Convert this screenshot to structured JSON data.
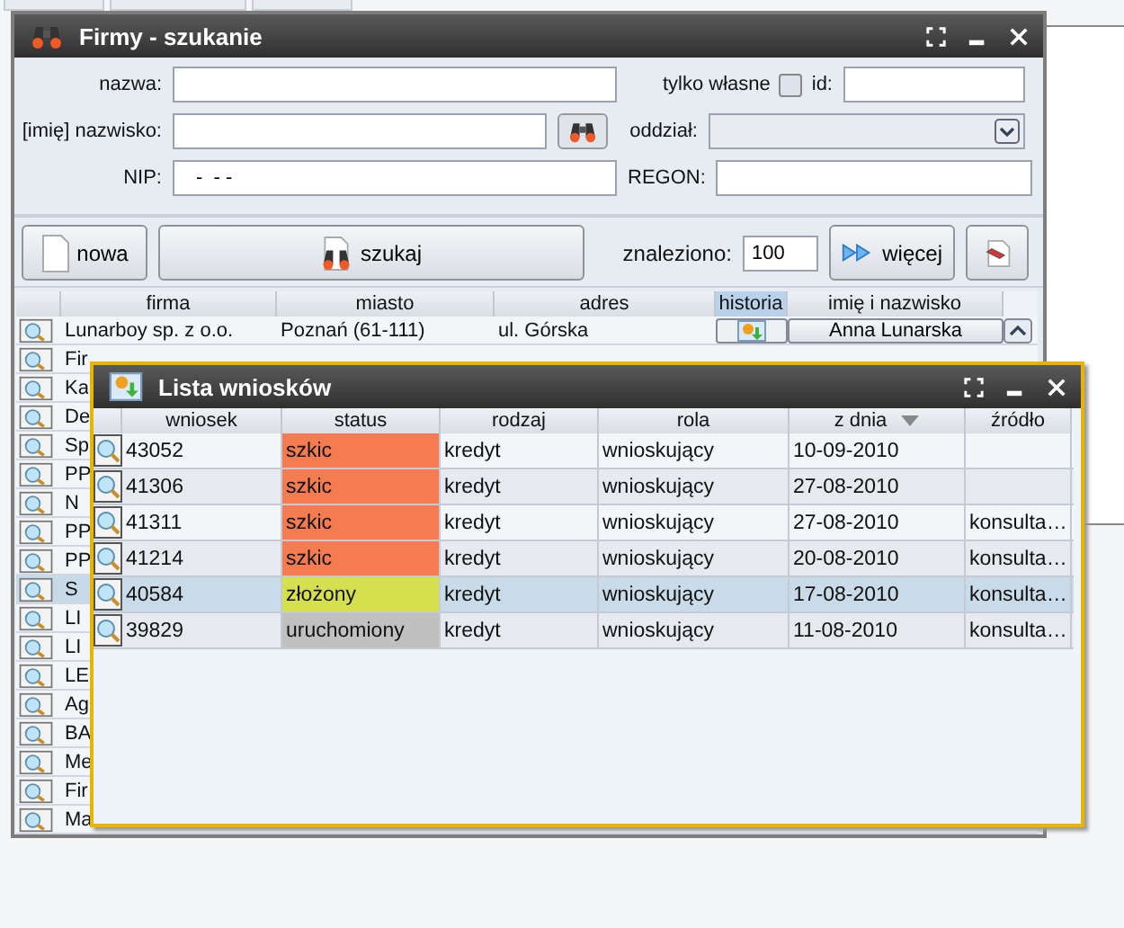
{
  "search_window": {
    "title": "Firmy - szukanie",
    "fields": {
      "name_label": "nazwa:",
      "own_label": "tylko własne",
      "own_checked": false,
      "id_label": "id:",
      "person_label": "[imię] nazwisko:",
      "branch_label": "oddział:",
      "nip_label": "NIP:",
      "nip_value": "-  - -",
      "regon_label": "REGON:"
    },
    "buttons": {
      "new": "nowa",
      "search": "szukaj",
      "found_label": "znaleziono:",
      "found_value": "100",
      "more": "więcej"
    },
    "columns": [
      {
        "label": "firma",
        "active": false
      },
      {
        "label": "miasto",
        "active": false
      },
      {
        "label": "adres",
        "active": false
      },
      {
        "label": "historia",
        "active": true
      },
      {
        "label": "imię i nazwisko",
        "active": false
      }
    ],
    "rows": [
      {
        "firma": "Lunarboy sp. z o.o.",
        "miasto": "Poznań (61-111)",
        "adres": "ul. Górska",
        "osoba": "Anna Lunarska",
        "selected": false
      },
      {
        "firma": "Fir",
        "selected": false
      },
      {
        "firma": "Ka",
        "selected": false
      },
      {
        "firma": "De",
        "selected": false
      },
      {
        "firma": "Sp",
        "selected": false
      },
      {
        "firma": "PP",
        "selected": false
      },
      {
        "firma": "N",
        "selected": false
      },
      {
        "firma": "PP",
        "selected": false
      },
      {
        "firma": "PP",
        "selected": false
      },
      {
        "firma": "S",
        "selected": true
      },
      {
        "firma": "LI",
        "selected": false
      },
      {
        "firma": "LI",
        "selected": false
      },
      {
        "firma": "LE",
        "selected": false
      },
      {
        "firma": "Ag",
        "selected": false
      },
      {
        "firma": "BA",
        "selected": false
      },
      {
        "firma": "Me",
        "selected": false
      },
      {
        "firma": "Fir",
        "selected": false
      },
      {
        "firma": "Ma",
        "selected": false
      }
    ]
  },
  "list_window": {
    "title": "Lista wniosków",
    "columns": [
      {
        "label": "wniosek",
        "sorted": false
      },
      {
        "label": "status",
        "sorted": false
      },
      {
        "label": "rodzaj",
        "sorted": false
      },
      {
        "label": "rola",
        "sorted": false
      },
      {
        "label": "z dnia",
        "sorted": true
      },
      {
        "label": "źródło",
        "sorted": false
      }
    ],
    "rows": [
      {
        "wniosek": "43052",
        "status": "szkic",
        "color": "#f47c50",
        "rodzaj": "kredyt",
        "rola": "wnioskujący",
        "z_dnia": "10-09-2010",
        "zrodlo": "",
        "selected": false
      },
      {
        "wniosek": "41306",
        "status": "szkic",
        "color": "#f47c50",
        "rodzaj": "kredyt",
        "rola": "wnioskujący",
        "z_dnia": "27-08-2010",
        "zrodlo": "",
        "selected": false
      },
      {
        "wniosek": "41311",
        "status": "szkic",
        "color": "#f47c50",
        "rodzaj": "kredyt",
        "rola": "wnioskujący",
        "z_dnia": "27-08-2010",
        "zrodlo": "konsulta…",
        "selected": false
      },
      {
        "wniosek": "41214",
        "status": "szkic",
        "color": "#f47c50",
        "rodzaj": "kredyt",
        "rola": "wnioskujący",
        "z_dnia": "20-08-2010",
        "zrodlo": "konsulta…",
        "selected": false
      },
      {
        "wniosek": "40584",
        "status": "złożony",
        "color": "#d6e04e",
        "rodzaj": "kredyt",
        "rola": "wnioskujący",
        "z_dnia": "17-08-2010",
        "zrodlo": "konsulta…",
        "selected": true
      },
      {
        "wniosek": "39829",
        "status": "uruchomiony",
        "color": "#c0c0c0",
        "rodzaj": "kredyt",
        "rola": "wnioskujący",
        "z_dnia": "11-08-2010",
        "zrodlo": "konsulta…",
        "selected": false
      }
    ]
  }
}
